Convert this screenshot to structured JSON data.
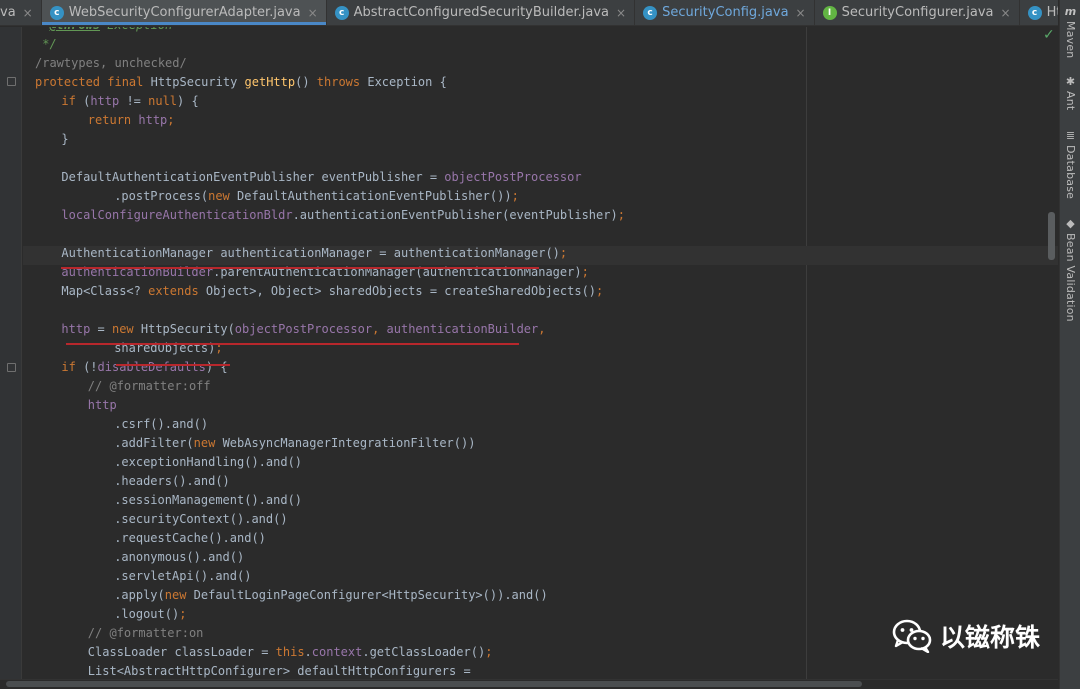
{
  "tabs": [
    {
      "label": "va",
      "icon": "",
      "active": false,
      "clipped": true,
      "blue": false
    },
    {
      "label": "WebSecurityConfigurerAdapter.java",
      "icon": "c",
      "active": true,
      "clipped": false,
      "blue": false
    },
    {
      "label": "AbstractConfiguredSecurityBuilder.java",
      "icon": "c",
      "active": false,
      "clipped": false,
      "blue": false
    },
    {
      "label": "SecurityConfig.java",
      "icon": "c",
      "active": false,
      "clipped": false,
      "blue": true
    },
    {
      "label": "SecurityConfigurer.java",
      "icon": "i",
      "active": false,
      "clipped": false,
      "blue": false
    },
    {
      "label": "HttpSecurity.java",
      "icon": "c",
      "active": false,
      "clipped": false,
      "blue": false
    }
  ],
  "tab_close_glyph": "×",
  "tab_overflow": "▾≡",
  "icon_letters": {
    "c": "c",
    "i": "I"
  },
  "side_tools": [
    {
      "label": "Maven",
      "icon": "maven-icon",
      "glyph": "m"
    },
    {
      "label": "Ant",
      "icon": "ant-icon",
      "glyph": "✱"
    },
    {
      "label": "Database",
      "icon": "database-icon",
      "glyph": "≣"
    },
    {
      "label": "Bean Validation",
      "icon": "bean-validation-icon",
      "glyph": "◆"
    }
  ],
  "inspection_status": "✓",
  "watermark": {
    "text": "以镃称铢",
    "icon": "wechat-icon"
  },
  "code_lines": [
    {
      "indent": 4,
      "segments": [
        [
          "cmt",
          "* "
        ],
        [
          "ctag",
          "@throws"
        ],
        [
          "cmt",
          " Exception"
        ]
      ]
    },
    {
      "indent": 4,
      "segments": [
        [
          "cmt",
          " */"
        ]
      ]
    },
    {
      "indent": 4,
      "segments": [
        [
          "cm",
          "/rawtypes, unchecked/"
        ]
      ]
    },
    {
      "indent": 4,
      "segments": [
        [
          "k",
          "protected final "
        ],
        [
          "t",
          "HttpSecurity "
        ],
        [
          "m",
          "getHttp"
        ],
        [
          "t",
          "() "
        ],
        [
          "k",
          "throws "
        ],
        [
          "t",
          "Exception {"
        ]
      ]
    },
    {
      "indent": 8,
      "segments": [
        [
          "k",
          "if "
        ],
        [
          "t",
          "("
        ],
        [
          "p",
          "http "
        ],
        [
          "t",
          "!= "
        ],
        [
          "k",
          "null"
        ],
        [
          "t",
          ") {"
        ]
      ]
    },
    {
      "indent": 12,
      "segments": [
        [
          "k",
          "return "
        ],
        [
          "p",
          "http"
        ],
        [
          "k",
          ";"
        ]
      ]
    },
    {
      "indent": 8,
      "segments": [
        [
          "t",
          "}"
        ]
      ]
    },
    {
      "indent": 0,
      "segments": []
    },
    {
      "indent": 8,
      "segments": [
        [
          "t",
          "DefaultAuthenticationEventPublisher eventPublisher = "
        ],
        [
          "p",
          "objectPostProcessor"
        ]
      ]
    },
    {
      "indent": 16,
      "segments": [
        [
          "t",
          ".postProcess("
        ],
        [
          "k",
          "new "
        ],
        [
          "t",
          "DefaultAuthenticationEventPublisher())"
        ],
        [
          "k",
          ";"
        ]
      ]
    },
    {
      "indent": 8,
      "segments": [
        [
          "p",
          "localConfigureAuthenticationBldr"
        ],
        [
          "t",
          ".authenticationEventPublisher(eventPublisher)"
        ],
        [
          "k",
          ";"
        ]
      ]
    },
    {
      "indent": 0,
      "segments": []
    },
    {
      "indent": 8,
      "segments": [
        [
          "t",
          "AuthenticationManager authenticationManager = authenticationManager()"
        ],
        [
          "k",
          ";"
        ]
      ]
    },
    {
      "indent": 8,
      "segments": [
        [
          "p",
          "authenticationBuilder"
        ],
        [
          "t",
          ".parentAuthenticationManager(authenticationManager)"
        ],
        [
          "k",
          ";"
        ]
      ]
    },
    {
      "indent": 8,
      "segments": [
        [
          "t",
          "Map<Class<? "
        ],
        [
          "k",
          "extends "
        ],
        [
          "t",
          "Object>, Object> sharedObjects = createSharedObjects()"
        ],
        [
          "k",
          ";"
        ]
      ]
    },
    {
      "indent": 0,
      "segments": []
    },
    {
      "indent": 8,
      "segments": [
        [
          "p",
          "http "
        ],
        [
          "t",
          "= "
        ],
        [
          "k",
          "new "
        ],
        [
          "t",
          "HttpSecurity("
        ],
        [
          "p",
          "objectPostProcessor"
        ],
        [
          "k",
          ", "
        ],
        [
          "p",
          "authenticationBuilder"
        ],
        [
          "k",
          ","
        ]
      ]
    },
    {
      "indent": 16,
      "segments": [
        [
          "t",
          "sharedObjects)"
        ],
        [
          "k",
          ";"
        ]
      ]
    },
    {
      "indent": 8,
      "segments": [
        [
          "k",
          "if "
        ],
        [
          "t",
          "(!"
        ],
        [
          "p",
          "disableDefaults"
        ],
        [
          "t",
          ") {"
        ]
      ]
    },
    {
      "indent": 12,
      "segments": [
        [
          "cm",
          "// @formatter:off"
        ]
      ]
    },
    {
      "indent": 12,
      "segments": [
        [
          "p",
          "http"
        ]
      ]
    },
    {
      "indent": 16,
      "segments": [
        [
          "t",
          ".csrf().and()"
        ]
      ]
    },
    {
      "indent": 16,
      "segments": [
        [
          "t",
          ".addFilter("
        ],
        [
          "k",
          "new "
        ],
        [
          "t",
          "WebAsyncManagerIntegrationFilter())"
        ]
      ]
    },
    {
      "indent": 16,
      "segments": [
        [
          "t",
          ".exceptionHandling().and()"
        ]
      ]
    },
    {
      "indent": 16,
      "segments": [
        [
          "t",
          ".headers().and()"
        ]
      ]
    },
    {
      "indent": 16,
      "segments": [
        [
          "t",
          ".sessionManagement().and()"
        ]
      ]
    },
    {
      "indent": 16,
      "segments": [
        [
          "t",
          ".securityContext().and()"
        ]
      ]
    },
    {
      "indent": 16,
      "segments": [
        [
          "t",
          ".requestCache().and()"
        ]
      ]
    },
    {
      "indent": 16,
      "segments": [
        [
          "t",
          ".anonymous().and()"
        ]
      ]
    },
    {
      "indent": 16,
      "segments": [
        [
          "t",
          ".servletApi().and()"
        ]
      ]
    },
    {
      "indent": 16,
      "segments": [
        [
          "t",
          ".apply("
        ],
        [
          "k",
          "new "
        ],
        [
          "t",
          "DefaultLoginPageConfigurer<HttpSecurity>()).and()"
        ]
      ]
    },
    {
      "indent": 16,
      "segments": [
        [
          "t",
          ".logout()"
        ],
        [
          "k",
          ";"
        ]
      ]
    },
    {
      "indent": 12,
      "segments": [
        [
          "cm",
          "// @formatter:on"
        ]
      ]
    },
    {
      "indent": 12,
      "segments": [
        [
          "t",
          "ClassLoader classLoader = "
        ],
        [
          "k",
          "this"
        ],
        [
          "t",
          "."
        ],
        [
          "p",
          "context"
        ],
        [
          "t",
          ".getClassLoader()"
        ],
        [
          "k",
          ";"
        ]
      ]
    },
    {
      "indent": 12,
      "segments": [
        [
          "t",
          "List<AbstractHttpConfigurer> defaultHttpConfigurers ="
        ]
      ]
    }
  ]
}
